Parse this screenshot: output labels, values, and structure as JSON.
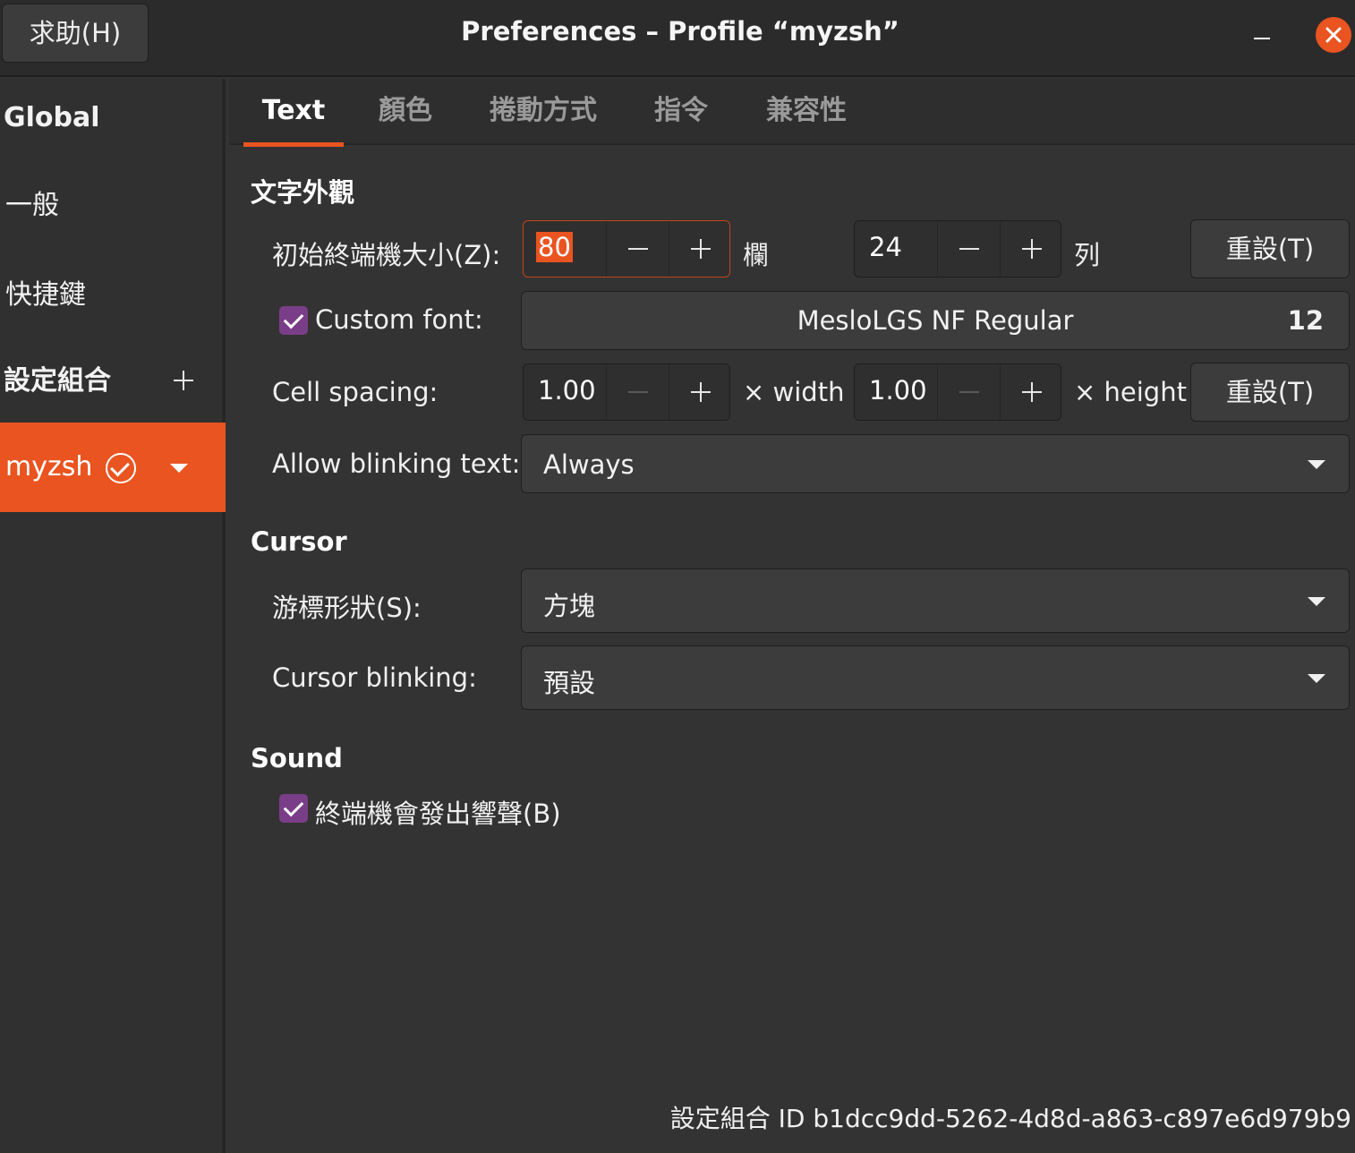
{
  "header": {
    "help_button": "求助(H)",
    "title": "Preferences – Profile “myzsh”"
  },
  "sidebar": {
    "global_label": "Global",
    "general_label": "一般",
    "shortcuts_label": "快捷鍵",
    "profiles_label": "設定組合",
    "profile_name": "myzsh"
  },
  "tabs": [
    "Text",
    "顏色",
    "捲動方式",
    "指令",
    "兼容性"
  ],
  "text_section": {
    "title": "文字外觀",
    "initial_size_label": "初始終端機大小(Z):",
    "columns_value": "80",
    "columns_unit": "欄",
    "rows_value": "24",
    "rows_unit": "列",
    "reset_button": "重設(T)",
    "custom_font_label": "Custom font:",
    "custom_font_checked": true,
    "font_name": "MesloLGS NF Regular",
    "font_size": "12",
    "cell_spacing_label": "Cell spacing:",
    "cell_width_value": "1.00",
    "cell_width_unit": "× width",
    "cell_height_value": "1.00",
    "cell_height_unit": "× height",
    "reset_button_2": "重設(T)",
    "blinking_text_label": "Allow blinking text:",
    "blinking_text_value": "Always"
  },
  "cursor_section": {
    "title": "Cursor",
    "shape_label": "游標形狀(S):",
    "shape_value": "方塊",
    "blinking_label": "Cursor blinking:",
    "blinking_value": "預設"
  },
  "sound_section": {
    "title": "Sound",
    "bell_label": "終端機會發出響聲(B)",
    "bell_checked": true
  },
  "footer": {
    "profile_id": "設定組合 ID  b1dcc9dd-5262-4d8d-a863-c897e6d979b9"
  },
  "colors": {
    "accent": "#e95420",
    "checkbox": "#7a3e88",
    "background": "#333333"
  }
}
